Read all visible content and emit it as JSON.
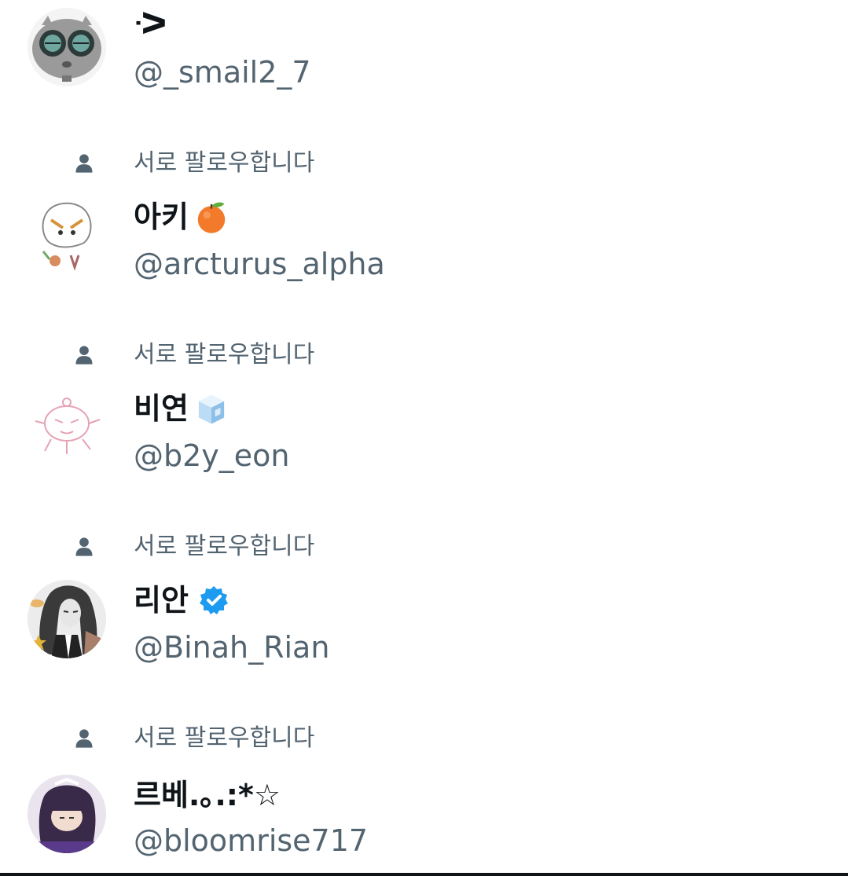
{
  "mutual_label": "서로 팔로우합니다",
  "users": [
    {
      "name": "ᑀ",
      "handle": "@_smail2_7",
      "mutual": false
    },
    {
      "name": "아키",
      "handle": "@arcturus_alpha",
      "mutual": true,
      "name_icon": "tangerine-emoji"
    },
    {
      "name": "비연",
      "handle": "@b2y_eon",
      "mutual": true,
      "name_icon": "ice-cube-emoji"
    },
    {
      "name": "리안",
      "handle": "@Binah_Rian",
      "mutual": true,
      "name_icon": "verified-badge-icon"
    },
    {
      "name": "르베.｡.:*☆",
      "handle": "@bloomrise717",
      "mutual": true
    }
  ],
  "colors": {
    "secondary_text": "#536471",
    "primary_text": "#0f1419",
    "verified_blue": "#1d9bf0"
  }
}
